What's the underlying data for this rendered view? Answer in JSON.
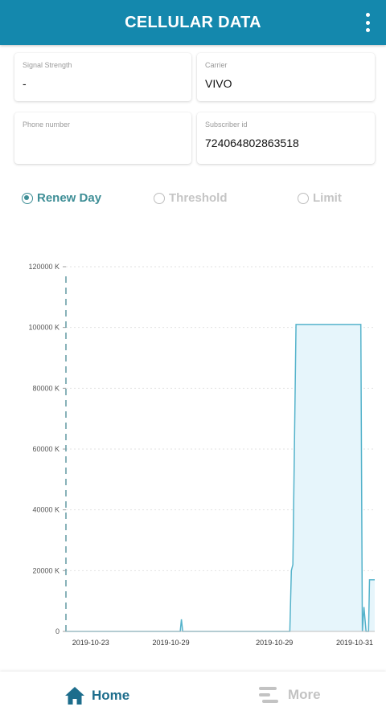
{
  "header": {
    "title": "CELLULAR DATA",
    "menu_icon": "more-vert-icon"
  },
  "info": {
    "signal_strength": {
      "label": "Signal Strength",
      "value": "-"
    },
    "carrier": {
      "label": "Carrier",
      "value": "VIVO"
    },
    "phone_number": {
      "label": "Phone number",
      "value": ""
    },
    "subscriber_id": {
      "label": "Subscriber id",
      "value": "724064802863518"
    }
  },
  "mode_options": [
    {
      "label": "Renew Day",
      "selected": true
    },
    {
      "label": "Threshold",
      "selected": false
    },
    {
      "label": "Limit",
      "selected": false
    }
  ],
  "chart_data": {
    "type": "area",
    "y_unit": "K",
    "ylim": [
      0,
      120000
    ],
    "yticks": [
      0,
      20000,
      40000,
      60000,
      80000,
      100000,
      120000
    ],
    "ytick_labels": [
      "0",
      "20000 K",
      "40000 K",
      "60000 K",
      "80000 K",
      "100000 K",
      "120000 K"
    ],
    "xtick_labels": [
      "2019-10-23",
      "2019-10-29",
      "2019-10-29",
      "2019-10-31"
    ],
    "series": [
      {
        "values": [
          [
            0,
            0
          ],
          [
            0.37,
            0
          ],
          [
            0.374,
            4000
          ],
          [
            0.378,
            0
          ],
          [
            0.725,
            0
          ],
          [
            0.73,
            20000
          ],
          [
            0.735,
            22000
          ],
          [
            0.745,
            101000
          ],
          [
            0.955,
            101000
          ],
          [
            0.96,
            0
          ],
          [
            0.965,
            8000
          ],
          [
            0.972,
            0
          ],
          [
            0.98,
            0
          ],
          [
            0.983,
            17000
          ],
          [
            1.0,
            17000
          ]
        ],
        "color": "#55b3cb",
        "fill": "#e6f5fb"
      }
    ],
    "grid": true,
    "legend": "none"
  },
  "colors": {
    "primary": "#1488ad",
    "accent": "#3e8e96",
    "nav_active": "#1d6d8c",
    "inactive": "#c3c3c3"
  },
  "bottom_nav": [
    {
      "label": "Home",
      "icon": "home-icon",
      "active": true
    },
    {
      "label": "More",
      "icon": "more-lines-icon",
      "active": false
    }
  ]
}
